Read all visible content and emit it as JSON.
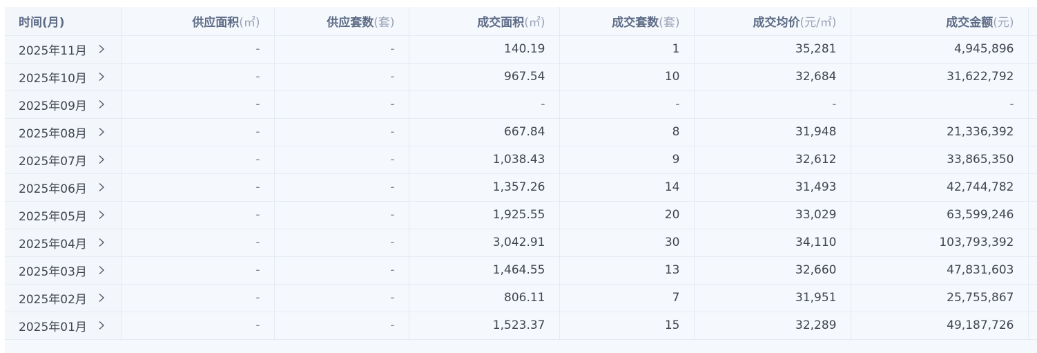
{
  "table": {
    "headers": [
      {
        "label": "时间(月)",
        "unit": ""
      },
      {
        "label": "供应面积",
        "unit": "(㎡)"
      },
      {
        "label": "供应套数",
        "unit": "(套)"
      },
      {
        "label": "成交面积",
        "unit": "(㎡)"
      },
      {
        "label": "成交套数",
        "unit": "(套)"
      },
      {
        "label": "成交均价",
        "unit": "(元/㎡)"
      },
      {
        "label": "成交金额",
        "unit": "(元)"
      }
    ],
    "rows": [
      [
        "2025年11月",
        "-",
        "-",
        "140.19",
        "1",
        "35,281",
        "4,945,896"
      ],
      [
        "2025年10月",
        "-",
        "-",
        "967.54",
        "10",
        "32,684",
        "31,622,792"
      ],
      [
        "2025年09月",
        "-",
        "-",
        "-",
        "-",
        "-",
        "-"
      ],
      [
        "2025年08月",
        "-",
        "-",
        "667.84",
        "8",
        "31,948",
        "21,336,392"
      ],
      [
        "2025年07月",
        "-",
        "-",
        "1,038.43",
        "9",
        "32,612",
        "33,865,350"
      ],
      [
        "2025年06月",
        "-",
        "-",
        "1,357.26",
        "14",
        "31,493",
        "42,744,782"
      ],
      [
        "2025年05月",
        "-",
        "-",
        "1,925.55",
        "20",
        "33,029",
        "63,599,246"
      ],
      [
        "2025年04月",
        "-",
        "-",
        "3,042.91",
        "30",
        "34,110",
        "103,793,392"
      ],
      [
        "2025年03月",
        "-",
        "-",
        "1,464.55",
        "13",
        "32,660",
        "47,831,603"
      ],
      [
        "2025年02月",
        "-",
        "-",
        "806.11",
        "7",
        "31,951",
        "25,755,867"
      ],
      [
        "2025年01月",
        "-",
        "-",
        "1,523.37",
        "15",
        "32,289",
        "49,187,726"
      ]
    ]
  },
  "icons": {
    "row_expand": "chevron-right-icon"
  },
  "colors": {
    "header_text": "#5d6b86",
    "unit_text": "#9aa3b8",
    "cell_text": "#40454f",
    "row_background": "#f5f8fc",
    "border": "#e6ebf2"
  }
}
